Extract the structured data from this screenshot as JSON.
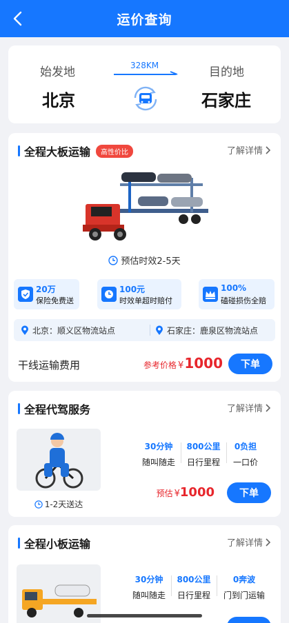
{
  "header": {
    "title": "运价查询"
  },
  "route": {
    "origin_label": "始发地",
    "destination_label": "目的地",
    "origin_city": "北京",
    "destination_city": "石家庄",
    "distance": "328KM"
  },
  "big_board": {
    "title": "全程大板运输",
    "tag": "高性价比",
    "more": "了解详情",
    "eta": "预估时效2-5天",
    "features": [
      {
        "value": "20万",
        "desc": "保险免费送",
        "icon": "shield-icon"
      },
      {
        "value": "100元",
        "desc": "时效单超时赔付",
        "icon": "clock-icon"
      },
      {
        "value": "100%",
        "desc": "磕碰损伤全赔",
        "icon": "crown-icon"
      }
    ],
    "stations": {
      "origin": "北京：顺义区物流站点",
      "destination": "石家庄：鹿泉区物流站点"
    },
    "fee_label": "干线运输费用",
    "price_label": "参考价格",
    "currency": "¥",
    "price": "1000",
    "order_button": "下单"
  },
  "driver": {
    "title": "全程代驾服务",
    "more": "了解详情",
    "stats": [
      {
        "value": "30分钟",
        "desc": "随叫随走"
      },
      {
        "value": "800公里",
        "desc": "日行里程"
      },
      {
        "value": "0负担",
        "desc": "一口价"
      }
    ],
    "delivery": "1-2天送达",
    "price_label": "预估",
    "currency": "¥",
    "price": "1000",
    "order_button": "下单"
  },
  "small_board": {
    "title": "全程小板运输",
    "more": "了解详情",
    "stats": [
      {
        "value": "30分钟",
        "desc": "随叫随走"
      },
      {
        "value": "800公里",
        "desc": "日行里程"
      },
      {
        "value": "0奔波",
        "desc": "门到门运输"
      }
    ]
  },
  "colors": {
    "primary": "#1677ff",
    "price": "#e7262c",
    "tag": "#f0483e"
  }
}
